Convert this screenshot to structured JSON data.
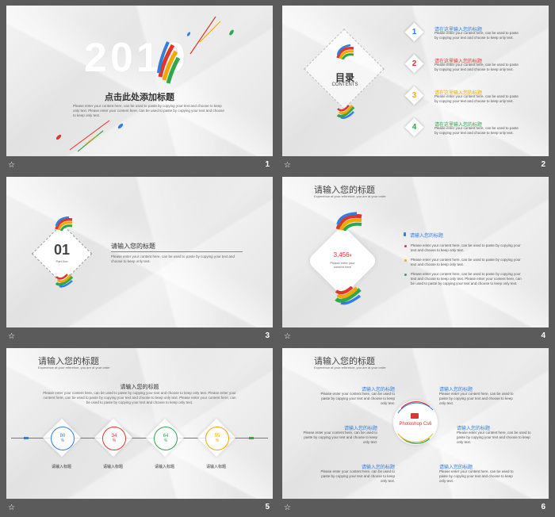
{
  "slides": [
    {
      "page": "1",
      "year": "2019",
      "title": "点击此处添加标题",
      "body": "Please enter your content here, can be used to paste by copying your text and choose to keep only text.  Please enter your content here, can be used to paste by copying your text and choose to keep only text."
    },
    {
      "page": "2",
      "toc_title": "目录",
      "toc_sub": "CONTENTS",
      "items": [
        {
          "num": "1",
          "title": "请在这里输入您的标题",
          "text": "Please enter your content here, can be used to paste by copying your text and choose to keep only text.",
          "color": "#2f7fe0"
        },
        {
          "num": "2",
          "title": "请在这里输入您的标题",
          "text": "Please enter your content here, can be used to paste by copying your text and choose to keep only text.",
          "color": "#e0352f"
        },
        {
          "num": "3",
          "title": "请在这里输入您的标题",
          "text": "Please enter your content here, can be used to paste by copying your text and choose to keep only text.",
          "color": "#f0a800"
        },
        {
          "num": "4",
          "title": "请在这里输入您的标题",
          "text": "Please enter your content here, can be used to paste by copying your text and choose to keep only text.",
          "color": "#2fa84a"
        }
      ]
    },
    {
      "page": "3",
      "part_num": "01",
      "part_label": "Part  0ne",
      "title": "请输入您的标题",
      "body": "Please enter your content here, can be used to paste by copying your text and choose to keep only text."
    },
    {
      "page": "4",
      "title": "请输入您的标题",
      "subtitle": "Experience at your reference, you are at your order",
      "center_value": "3,456",
      "center_unit": "¥",
      "center_text": "Please enter your content here",
      "items": [
        {
          "title": "请输入您的标题",
          "color": "#2f7fe0"
        },
        {
          "text": "Please enter your content here, can be used to paste by copying your text and choose to keep only text.",
          "color": "#e0352f"
        },
        {
          "text": "Please enter your content here, can be used to paste by copying your text and choose to keep only text.",
          "color": "#f0a800"
        },
        {
          "text": "Please enter your content here, can be used to paste by copying your text and choose to keep only text.  Please enter your content here, can be used to paste by copying your text and choose to keep only text.",
          "color": "#2fa84a"
        }
      ]
    },
    {
      "page": "5",
      "title": "请输入您的标题",
      "subtitle": "Experience at your reference, you are at your order",
      "sec_title": "请输入您的标题",
      "body": "Please enter your content here, can be used to paste by copying your text and choose to keep only text. Please enter your content here, can be used to paste by copying your text and choose to keep only text.  Please enter your content here, can be used to paste by copying your text and choose to keep only text.",
      "rings": [
        {
          "value": "80",
          "unit": "%",
          "label": "请输入标题",
          "color": "#2f7fe0"
        },
        {
          "value": "34",
          "unit": "%",
          "label": "请输入标题",
          "color": "#e0352f"
        },
        {
          "value": "64",
          "unit": "%",
          "label": "请输入标题",
          "color": "#2fa84a"
        },
        {
          "value": "55",
          "unit": "%",
          "label": "请输入标题",
          "color": "#f0a800"
        }
      ]
    },
    {
      "page": "6",
      "title": "请输入您的标题",
      "subtitle": "Experience at your reference, you are at your order",
      "center": "Photoshop Cs6",
      "items": [
        {
          "title": "请输入您的标题",
          "text": "Please enter your content here, can be used to paste by copying your text and choose to keep only text."
        },
        {
          "title": "请输入您的标题",
          "text": "Please enter your content here, can be used to paste by copying your text and choose to keep only text."
        },
        {
          "title": "请输入您的标题",
          "text": "Please enter your content here, can be used to paste by copying your text and choose to keep only text."
        },
        {
          "title": "请输入您的标题",
          "text": "Please enter your content here, can be used to paste by copying your text and choose to keep only text."
        },
        {
          "title": "请输入您的标题",
          "text": "Please enter your content here, can be used to paste by copying your text and choose to keep only text."
        },
        {
          "title": "请输入您的标题",
          "text": "Please enter your content here, can be used to paste by copying your text and choose to keep only text."
        }
      ]
    }
  ],
  "footer_icon": "star-icon"
}
